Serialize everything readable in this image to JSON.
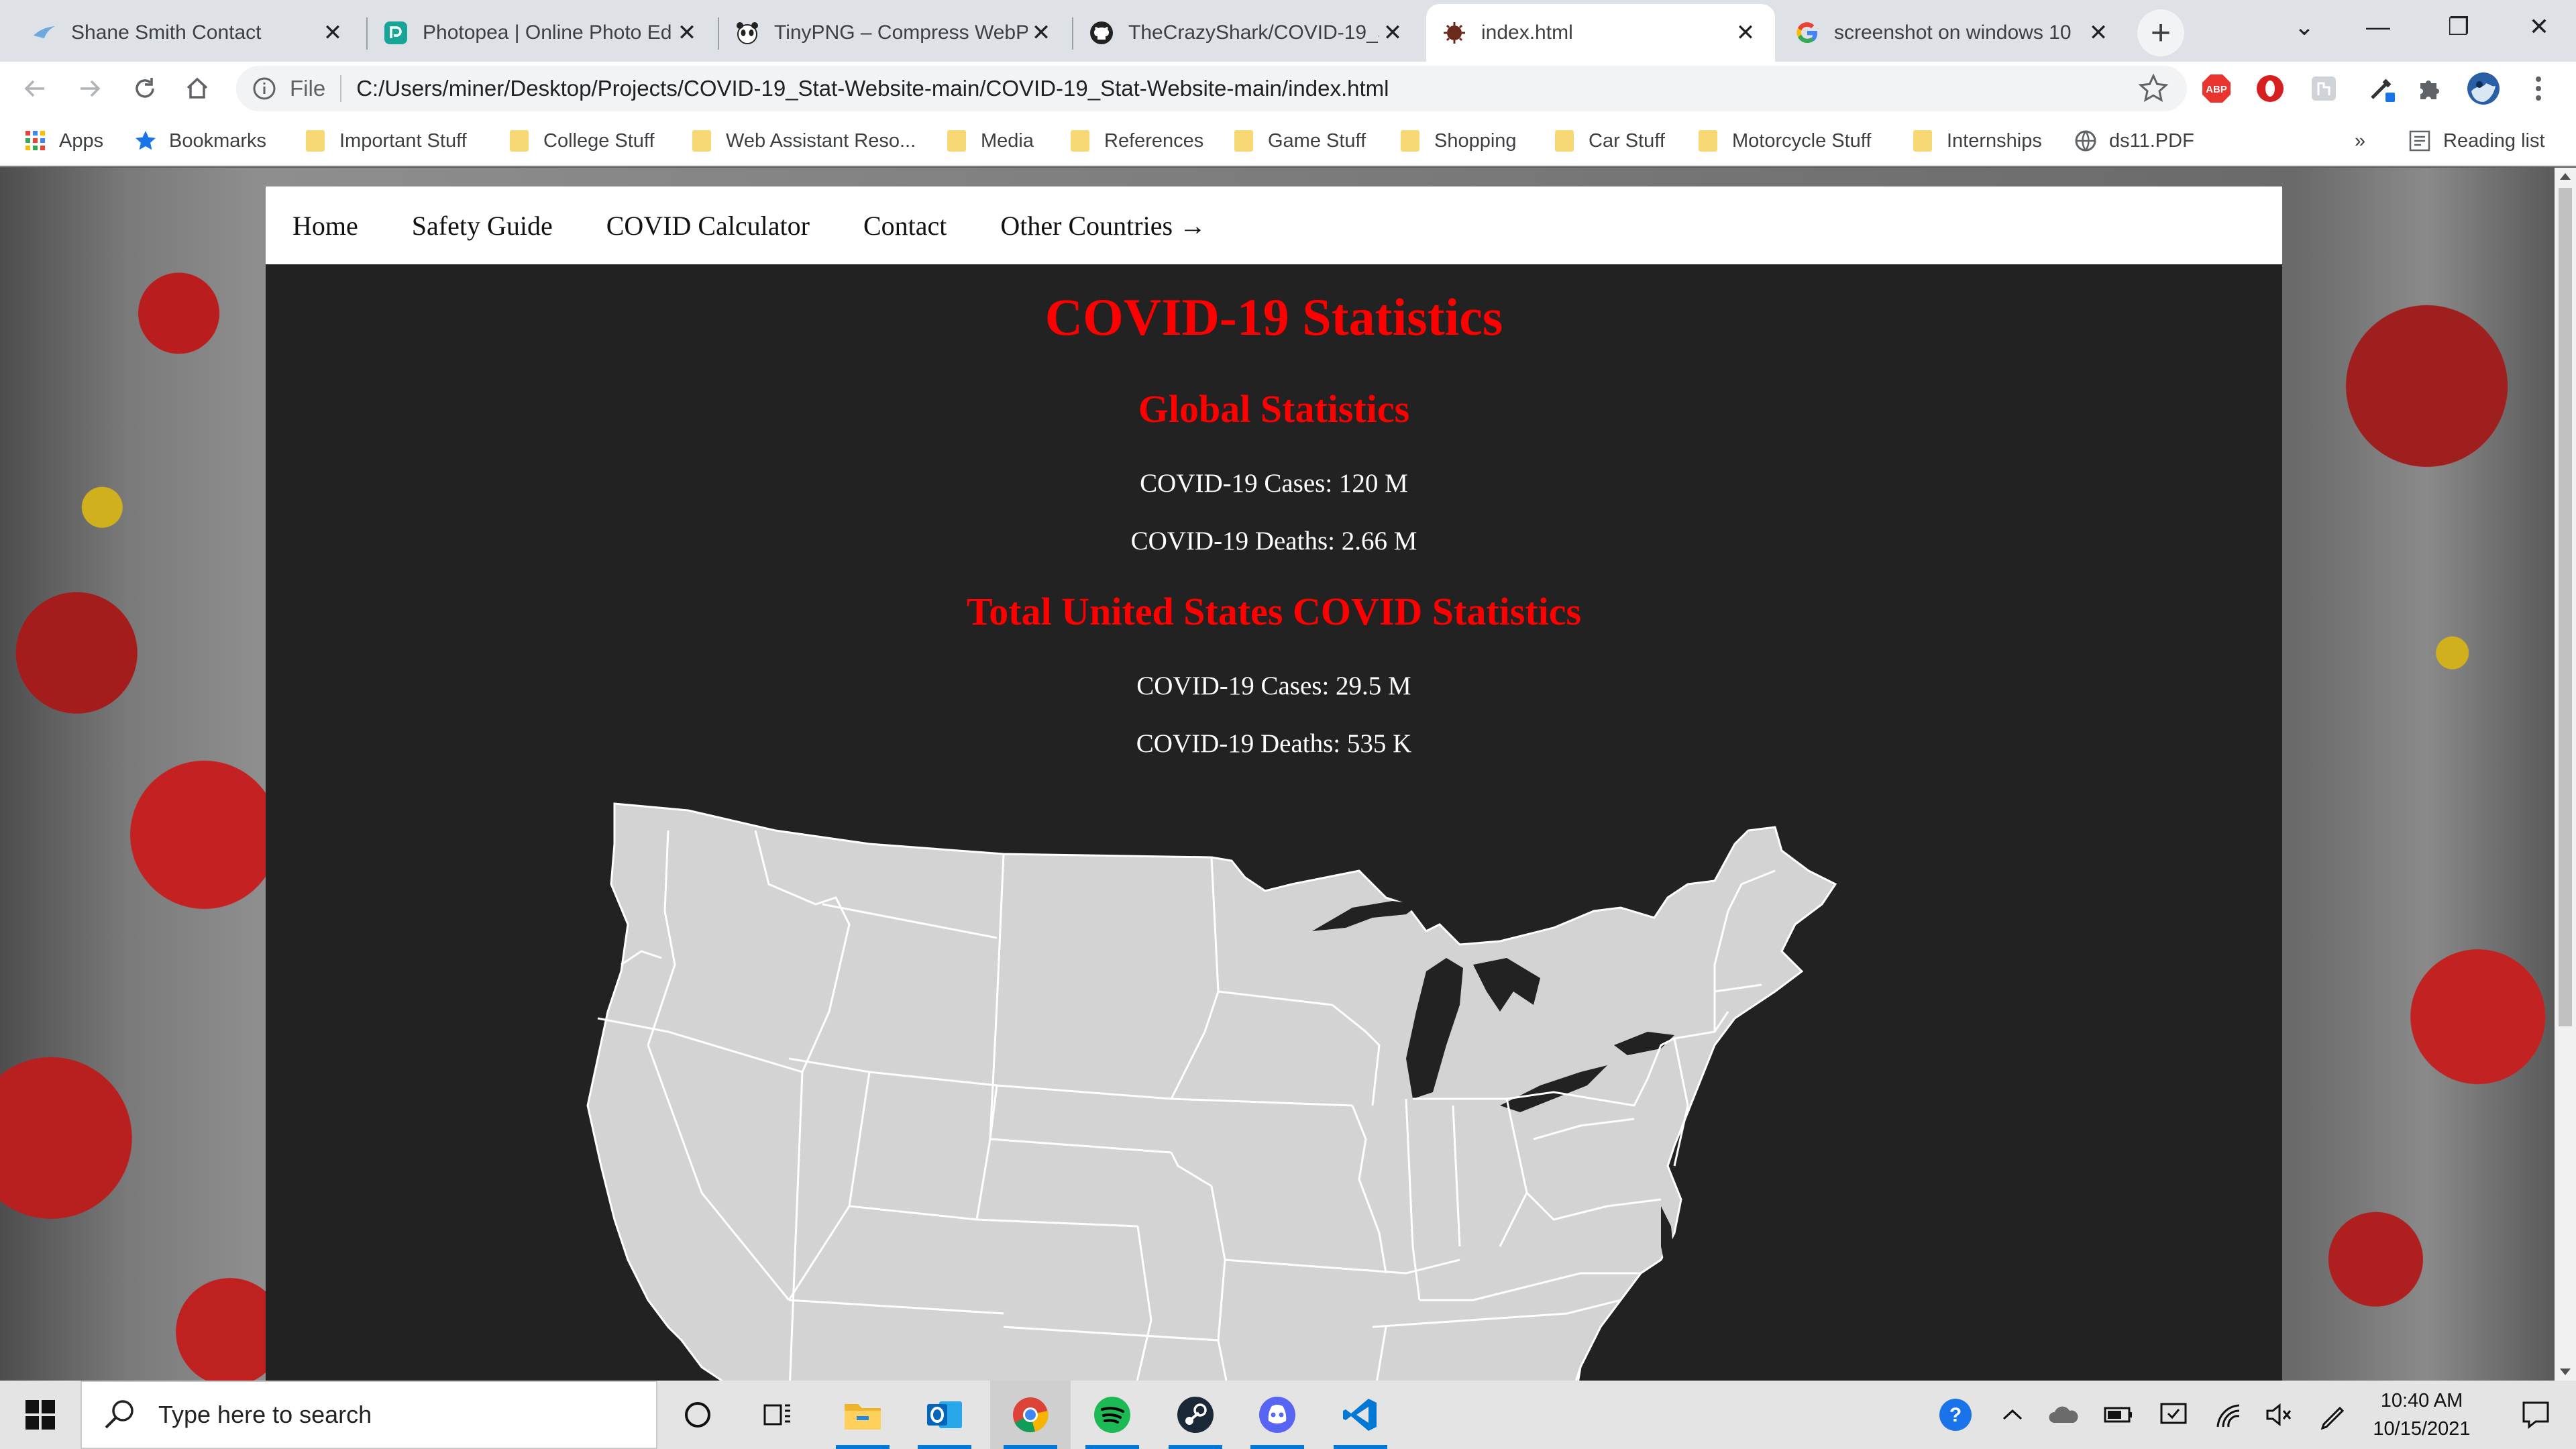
{
  "browser": {
    "tabs": [
      {
        "title": "Shane Smith Contact",
        "icon": "bird-favicon"
      },
      {
        "title": "Photopea | Online Photo Ed",
        "icon": "photopea-favicon"
      },
      {
        "title": "TinyPNG – Compress WebP",
        "icon": "panda-favicon"
      },
      {
        "title": "TheCrazyShark/COVID-19_S",
        "icon": "github-favicon"
      },
      {
        "title": "index.html",
        "icon": "covid-favicon"
      },
      {
        "title": "screenshot on windows 10",
        "icon": "google-favicon"
      }
    ],
    "active_tab_index": 4,
    "omnibox": {
      "scheme": "File",
      "url": "C:/Users/miner/Desktop/Projects/COVID-19_Stat-Website-main/COVID-19_Stat-Website-main/index.html"
    },
    "bookmarks": {
      "apps": "Apps",
      "bookmarks": "Bookmarks",
      "folders": [
        "Important Stuff",
        "College Stuff",
        "Web Assistant Reso...",
        "Media",
        "References",
        "Game Stuff",
        "Shopping",
        "Car Stuff",
        "Motorcycle Stuff",
        "Internships"
      ],
      "pdf": "ds11.PDF",
      "overflow": "»",
      "reading_list": "Reading list"
    }
  },
  "site": {
    "nav": [
      "Home",
      "Safety Guide",
      "COVID Calculator",
      "Contact",
      "Other Countries →"
    ],
    "title": "COVID-19 Statistics",
    "global": {
      "heading": "Global Statistics",
      "cases": "COVID-19 Cases: 120 M",
      "deaths": "COVID-19 Deaths: 2.66 M"
    },
    "us": {
      "heading": "Total United States COVID Statistics",
      "cases": "COVID-19 Cases: 29.5 M",
      "deaths": "COVID-19 Deaths: 535 K"
    },
    "colors": {
      "accent": "#ff0000",
      "page_bg": "#222222",
      "map_fill": "#d3d3d3"
    }
  },
  "taskbar": {
    "search_placeholder": "Type here to search",
    "time": "10:40 AM",
    "date": "10/15/2021",
    "apps": [
      "cortana-icon",
      "task-view-icon",
      "file-explorer-icon",
      "outlook-icon",
      "chrome-icon",
      "spotify-icon",
      "steam-icon",
      "discord-icon",
      "vscode-icon"
    ]
  }
}
